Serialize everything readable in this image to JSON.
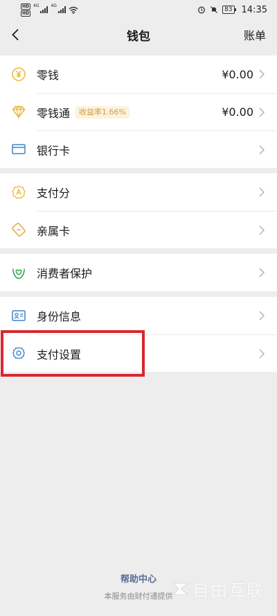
{
  "status_bar": {
    "hd1": "HD",
    "hd2": "HD",
    "net1": "4G",
    "net2": "4G",
    "battery": "83",
    "time": "14:35"
  },
  "nav": {
    "title": "钱包",
    "bill": "账单"
  },
  "groups": [
    {
      "rows": [
        {
          "label": "零钱",
          "value": "¥0.00",
          "icon": "yuan-coin-icon"
        },
        {
          "label": "零钱通",
          "badge": "收益率1.66%",
          "value": "¥0.00",
          "icon": "diamond-icon"
        },
        {
          "label": "银行卡",
          "icon": "bank-card-icon"
        }
      ]
    },
    {
      "rows": [
        {
          "label": "支付分",
          "icon": "pay-score-icon"
        },
        {
          "label": "亲属卡",
          "icon": "family-card-icon"
        }
      ]
    },
    {
      "rows": [
        {
          "label": "消费者保护",
          "icon": "consumer-protection-icon"
        }
      ]
    },
    {
      "rows": [
        {
          "label": "身份信息",
          "icon": "id-card-icon"
        },
        {
          "label": "支付设置",
          "icon": "gear-icon"
        }
      ]
    }
  ],
  "footer": {
    "help": "帮助中心",
    "provider": "本服务由财付通提供"
  },
  "watermark": "自由互联",
  "colors": {
    "accent_gold": "#e8b73a",
    "accent_blue": "#3b84c6",
    "accent_green": "#2ba245",
    "link": "#576b95",
    "highlight": "#d7282e"
  }
}
